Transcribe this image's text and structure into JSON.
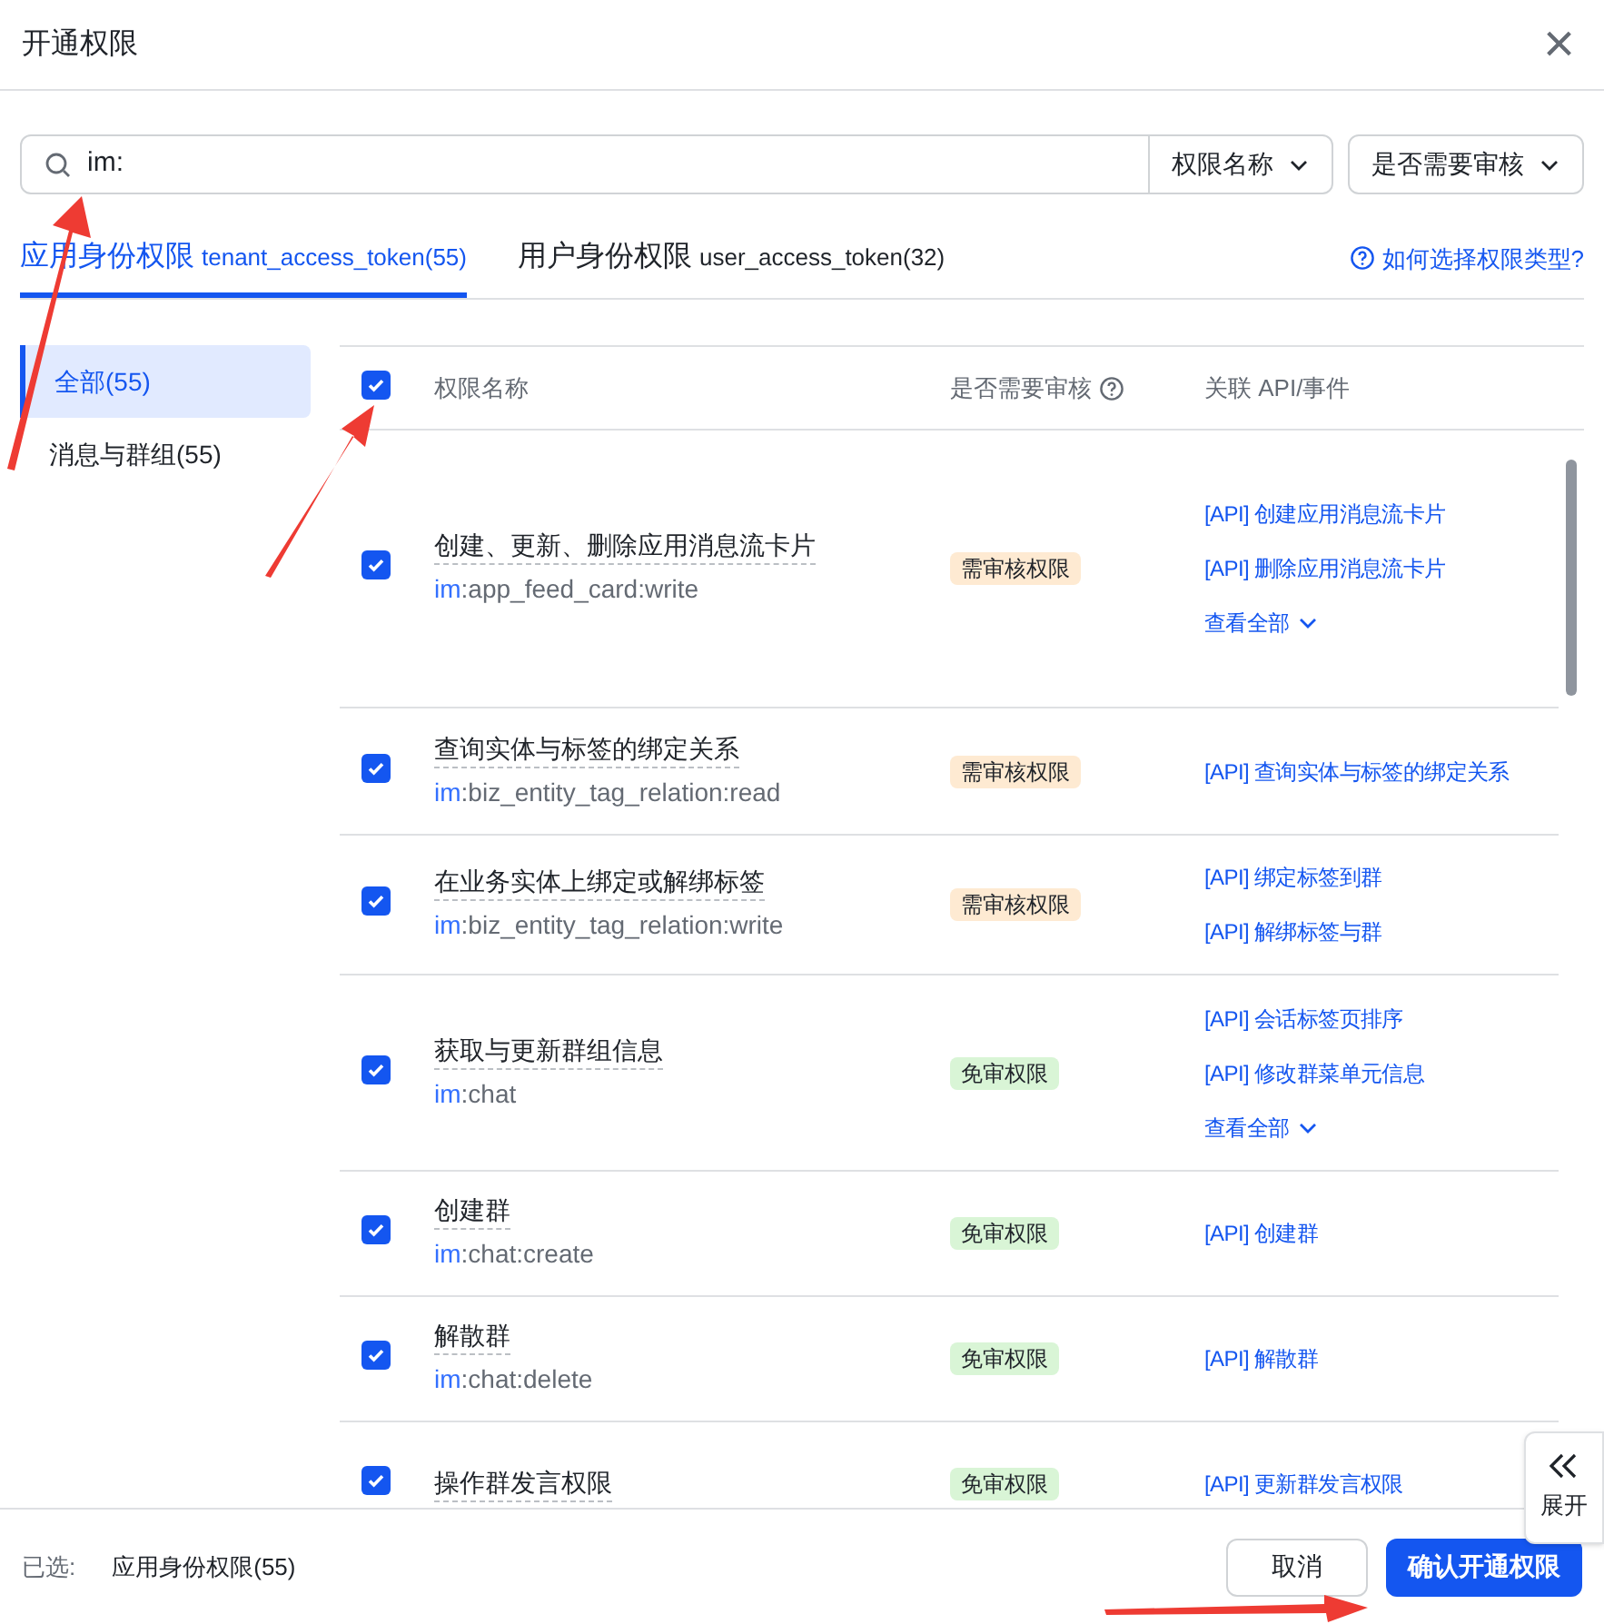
{
  "dialog": {
    "title": "开通权限",
    "close": "×"
  },
  "search": {
    "value": "im:",
    "field_select": "权限名称",
    "review_select": "是否需要审核"
  },
  "tabs": [
    {
      "label": "应用身份权限",
      "token": "tenant_access_token(55)",
      "selected": true
    },
    {
      "label": "用户身份权限",
      "token": "user_access_token(32)",
      "selected": false
    }
  ],
  "help_link": "如何选择权限类型?",
  "sidebar": {
    "items": [
      {
        "label": "全部(55)",
        "selected": true
      },
      {
        "label": "消息与群组(55)",
        "selected": false
      }
    ]
  },
  "table": {
    "select_all_checked": true,
    "columns": [
      "权限名称",
      "是否需要审核",
      "关联 API/事件"
    ],
    "rows": [
      {
        "checked": true,
        "name": "创建、更新、删除应用消息流卡片",
        "code_prefix": "im",
        "code_rest": ":app_feed_card:write",
        "review": {
          "kind": "required",
          "label": "需审核权限"
        },
        "apis": [
          "[API] 创建应用消息流卡片",
          "[API] 删除应用消息流卡片"
        ],
        "more": "查看全部"
      },
      {
        "checked": true,
        "name": "查询实体与标签的绑定关系",
        "code_prefix": "im",
        "code_rest": ":biz_entity_tag_relation:read",
        "review": {
          "kind": "required",
          "label": "需审核权限"
        },
        "apis": [
          "[API] 查询实体与标签的绑定关系"
        ]
      },
      {
        "checked": true,
        "name": "在业务实体上绑定或解绑标签",
        "code_prefix": "im",
        "code_rest": ":biz_entity_tag_relation:write",
        "review": {
          "kind": "required",
          "label": "需审核权限"
        },
        "apis": [
          "[API] 绑定标签到群",
          "[API] 解绑标签与群"
        ]
      },
      {
        "checked": true,
        "name": "获取与更新群组信息",
        "code_prefix": "im",
        "code_rest": ":chat",
        "review": {
          "kind": "free",
          "label": "免审权限"
        },
        "apis": [
          "[API] 会话标签页排序",
          "[API] 修改群菜单元信息"
        ],
        "more": "查看全部"
      },
      {
        "checked": true,
        "name": "创建群",
        "code_prefix": "im",
        "code_rest": ":chat:create",
        "review": {
          "kind": "free",
          "label": "免审权限"
        },
        "apis": [
          "[API] 创建群"
        ]
      },
      {
        "checked": true,
        "name": "解散群",
        "code_prefix": "im",
        "code_rest": ":chat:delete",
        "review": {
          "kind": "free",
          "label": "免审权限"
        },
        "apis": [
          "[API] 解散群"
        ]
      },
      {
        "checked": true,
        "name": "操作群发言权限",
        "review": {
          "kind": "free",
          "label": "免审权限"
        },
        "apis": [
          "[API] 更新群发言权限"
        ]
      }
    ]
  },
  "expand_button": "展开",
  "footer": {
    "selected_label": "已选:",
    "selected_value": "应用身份权限(55)",
    "cancel": "取消",
    "confirm": "确认开通权限"
  }
}
